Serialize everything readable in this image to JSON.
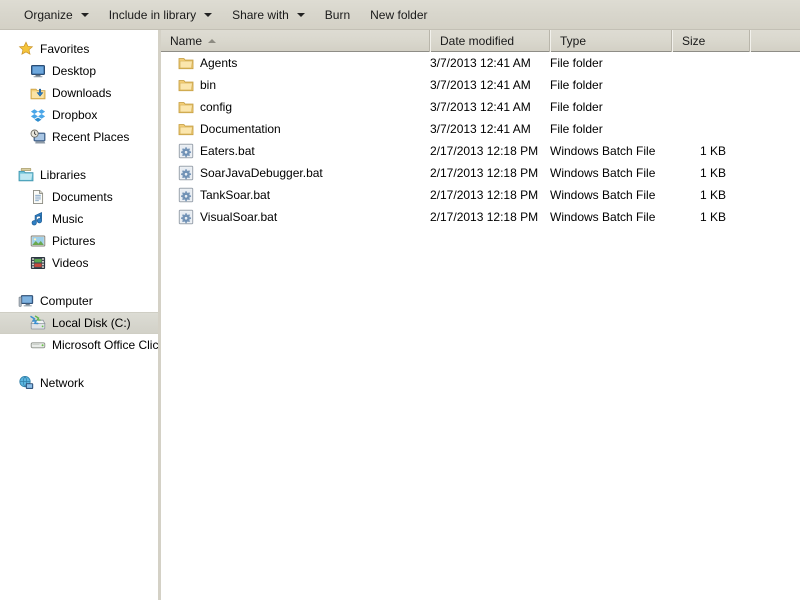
{
  "toolbar": {
    "items": [
      {
        "label": "Organize",
        "has_caret": true,
        "icon": "chevron-down-icon"
      },
      {
        "label": "Include in library",
        "has_caret": true,
        "icon": "chevron-down-icon"
      },
      {
        "label": "Share with",
        "has_caret": true,
        "icon": "chevron-down-icon"
      },
      {
        "label": "Burn",
        "has_caret": false,
        "icon": ""
      },
      {
        "label": "New folder",
        "has_caret": false,
        "icon": ""
      }
    ]
  },
  "sidebar": {
    "groups": [
      {
        "header": {
          "label": "Favorites",
          "icon": "star-icon",
          "selected": false
        },
        "items": [
          {
            "label": "Desktop",
            "icon": "desktop-icon",
            "selected": false
          },
          {
            "label": "Downloads",
            "icon": "downloads-folder-icon",
            "selected": false
          },
          {
            "label": "Dropbox",
            "icon": "dropbox-icon",
            "selected": false
          },
          {
            "label": "Recent Places",
            "icon": "recent-places-icon",
            "selected": false
          }
        ]
      },
      {
        "header": {
          "label": "Libraries",
          "icon": "libraries-icon",
          "selected": false
        },
        "items": [
          {
            "label": "Documents",
            "icon": "documents-icon",
            "selected": false
          },
          {
            "label": "Music",
            "icon": "music-note-icon",
            "selected": false
          },
          {
            "label": "Pictures",
            "icon": "pictures-icon",
            "selected": false
          },
          {
            "label": "Videos",
            "icon": "videos-film-icon",
            "selected": false
          }
        ]
      },
      {
        "header": {
          "label": "Computer",
          "icon": "computer-icon",
          "selected": false
        },
        "items": [
          {
            "label": "Local Disk (C:)",
            "icon": "local-disk-icon",
            "selected": true
          },
          {
            "label": "Microsoft Office Click-t",
            "icon": "drive-icon",
            "selected": false
          }
        ]
      },
      {
        "header": {
          "label": "Network",
          "icon": "network-icon",
          "selected": false
        },
        "items": []
      }
    ]
  },
  "file_list": {
    "columns": [
      {
        "key": "name",
        "label": "Name",
        "sort": "asc"
      },
      {
        "key": "date",
        "label": "Date modified",
        "sort": ""
      },
      {
        "key": "type",
        "label": "Type",
        "sort": ""
      },
      {
        "key": "size",
        "label": "Size",
        "sort": ""
      }
    ],
    "rows": [
      {
        "name": "Agents",
        "date": "3/7/2013 12:41 AM",
        "type": "File folder",
        "size": "",
        "icon": "folder-icon"
      },
      {
        "name": "bin",
        "date": "3/7/2013 12:41 AM",
        "type": "File folder",
        "size": "",
        "icon": "folder-icon"
      },
      {
        "name": "config",
        "date": "3/7/2013 12:41 AM",
        "type": "File folder",
        "size": "",
        "icon": "folder-icon"
      },
      {
        "name": "Documentation",
        "date": "3/7/2013 12:41 AM",
        "type": "File folder",
        "size": "",
        "icon": "folder-icon"
      },
      {
        "name": "Eaters.bat",
        "date": "2/17/2013 12:18 PM",
        "type": "Windows Batch File",
        "size": "1 KB",
        "icon": "batch-file-icon"
      },
      {
        "name": "SoarJavaDebugger.bat",
        "date": "2/17/2013 12:18 PM",
        "type": "Windows Batch File",
        "size": "1 KB",
        "icon": "batch-file-icon"
      },
      {
        "name": "TankSoar.bat",
        "date": "2/17/2013 12:18 PM",
        "type": "Windows Batch File",
        "size": "1 KB",
        "icon": "batch-file-icon"
      },
      {
        "name": "VisualSoar.bat",
        "date": "2/17/2013 12:18 PM",
        "type": "Windows Batch File",
        "size": "1 KB",
        "icon": "batch-file-icon"
      }
    ]
  },
  "colors": {
    "toolbar_bg": "#dedcd3",
    "header_bg": "#d9d7cd",
    "selection_bg": "#d8d7ce",
    "folder_yellow": "#f6d47a",
    "splitter": "#d4d1c6"
  }
}
